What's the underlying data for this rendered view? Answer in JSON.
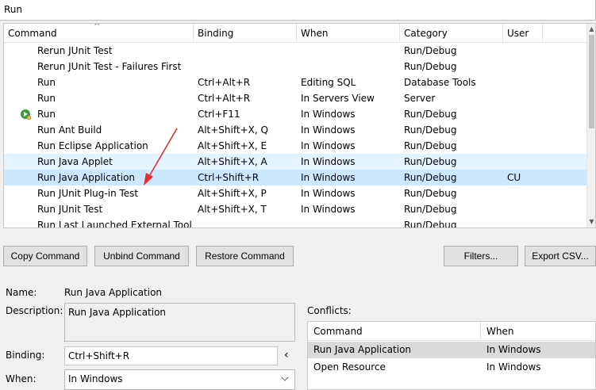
{
  "filter": {
    "value": "Run"
  },
  "table": {
    "columns": [
      "Command",
      "Binding",
      "When",
      "Category",
      "User"
    ],
    "rows": [
      {
        "command": "Rerun JUnit Test",
        "binding": "",
        "when": "",
        "category": "Run/Debug",
        "user": ""
      },
      {
        "command": "Rerun JUnit Test - Failures First",
        "binding": "",
        "when": "",
        "category": "Run/Debug",
        "user": ""
      },
      {
        "command": "Run",
        "binding": "Ctrl+Alt+R",
        "when": "Editing SQL",
        "category": "Database Tools",
        "user": ""
      },
      {
        "command": "Run",
        "binding": "Ctrl+Alt+R",
        "when": "In Servers View",
        "category": "Server",
        "user": ""
      },
      {
        "command": "Run",
        "binding": "Ctrl+F11",
        "when": "In Windows",
        "category": "Run/Debug",
        "user": ""
      },
      {
        "command": "Run Ant Build",
        "binding": "Alt+Shift+X, Q",
        "when": "In Windows",
        "category": "Run/Debug",
        "user": ""
      },
      {
        "command": "Run Eclipse Application",
        "binding": "Alt+Shift+X, E",
        "when": "In Windows",
        "category": "Run/Debug",
        "user": ""
      },
      {
        "command": "Run Java Applet",
        "binding": "Alt+Shift+X, A",
        "when": "In Windows",
        "category": "Run/Debug",
        "user": ""
      },
      {
        "command": "Run Java Application",
        "binding": "Ctrl+Shift+R",
        "when": "In Windows",
        "category": "Run/Debug",
        "user": "CU"
      },
      {
        "command": "Run JUnit Plug-in Test",
        "binding": "Alt+Shift+X, P",
        "when": "In Windows",
        "category": "Run/Debug",
        "user": ""
      },
      {
        "command": "Run JUnit Test",
        "binding": "Alt+Shift+X, T",
        "when": "In Windows",
        "category": "Run/Debug",
        "user": ""
      },
      {
        "command": "Run Last Launched External Tool",
        "binding": "",
        "when": "",
        "category": "Run/Debug",
        "user": ""
      }
    ]
  },
  "buttons": {
    "copy": "Copy Command",
    "unbind": "Unbind Command",
    "restore": "Restore Command",
    "filters": "Filters...",
    "export": "Export CSV..."
  },
  "details": {
    "name_label": "Name:",
    "name_value": "Run Java Application",
    "description_label": "Description:",
    "description_value": "Run Java Application",
    "binding_label": "Binding:",
    "binding_value": "Ctrl+Shift+R",
    "binding_menu_glyph": "‹",
    "when_label": "When:",
    "when_value": "In Windows"
  },
  "conflicts": {
    "label": "Conflicts:",
    "columns": [
      "Command",
      "When"
    ],
    "rows": [
      {
        "command": "Run Java Application",
        "when": "In Windows"
      },
      {
        "command": "Open Resource",
        "when": "In Windows"
      }
    ]
  },
  "colors": {
    "selected_row": "#cce8ff",
    "hover_row": "#e5f3ff",
    "annotation_arrow": "#e03030"
  }
}
